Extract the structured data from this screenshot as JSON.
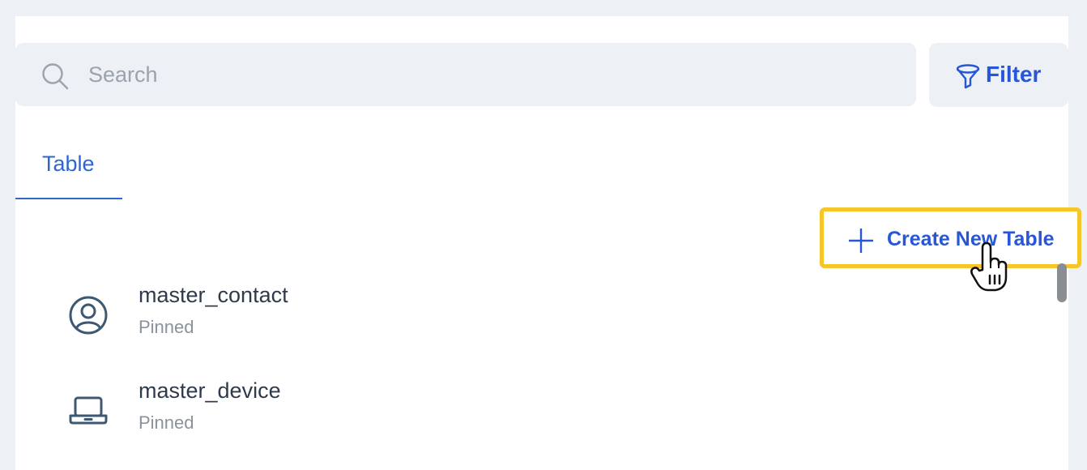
{
  "search": {
    "placeholder": "Search",
    "icon": "search-icon"
  },
  "filter": {
    "label": "Filter",
    "icon": "funnel-icon"
  },
  "tabs": [
    {
      "label": "Table",
      "active": true
    }
  ],
  "actions": {
    "create_label": "Create New Table",
    "icon": "plus-icon"
  },
  "tables": [
    {
      "name": "master_contact",
      "status": "Pinned",
      "icon": "user-circle-icon"
    },
    {
      "name": "master_device",
      "status": "Pinned",
      "icon": "laptop-icon"
    }
  ],
  "colors": {
    "accent": "#2756d6",
    "highlight": "#f6c52a",
    "icon_stroke": "#3d5872",
    "muted_text": "#8a929c",
    "field_bg": "#edf0f4"
  }
}
